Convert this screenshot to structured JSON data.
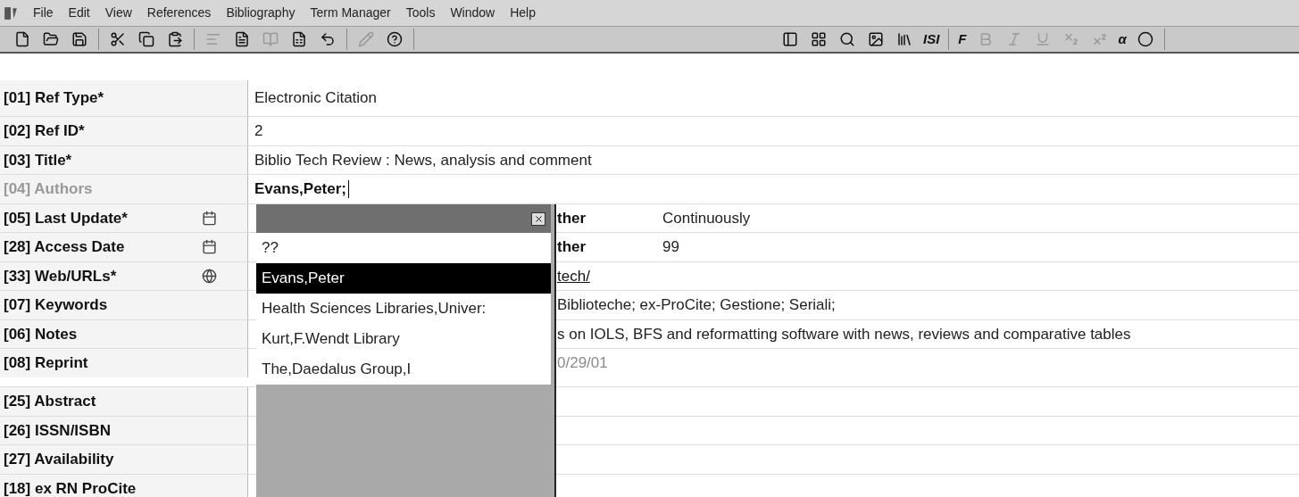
{
  "menu_bar": {
    "items": [
      "File",
      "Edit",
      "View",
      "References",
      "Bibliography",
      "Term Manager",
      "Tools",
      "Window",
      "Help"
    ]
  },
  "toolbar": {
    "groups": [
      [
        {
          "kind": "new",
          "disabled": false
        },
        {
          "kind": "open",
          "disabled": false
        },
        {
          "kind": "save",
          "disabled": false
        }
      ],
      [
        {
          "kind": "cut",
          "disabled": false
        },
        {
          "kind": "copy",
          "disabled": false
        },
        {
          "kind": "paste",
          "disabled": false
        }
      ],
      [
        {
          "kind": "align",
          "disabled": true
        },
        {
          "kind": "document",
          "disabled": false
        },
        {
          "kind": "book",
          "disabled": true
        },
        {
          "kind": "sheet",
          "disabled": false
        },
        {
          "kind": "undo",
          "disabled": false
        }
      ],
      [
        {
          "kind": "pencil",
          "disabled": true
        },
        {
          "kind": "help",
          "disabled": false
        }
      ],
      [
        {
          "kind": "layout",
          "disabled": false
        },
        {
          "kind": "grid",
          "disabled": false
        },
        {
          "kind": "search",
          "disabled": false
        },
        {
          "kind": "image",
          "disabled": false
        },
        {
          "kind": "library",
          "disabled": false
        },
        {
          "kind": "text",
          "label": "ISI",
          "disabled": false
        }
      ],
      [
        {
          "kind": "text",
          "label": "F",
          "disabled": false
        },
        {
          "kind": "bold",
          "disabled": true
        },
        {
          "kind": "italic",
          "disabled": true
        },
        {
          "kind": "underline",
          "disabled": true
        },
        {
          "kind": "subscript",
          "disabled": true
        },
        {
          "kind": "superscript",
          "disabled": true
        },
        {
          "kind": "text",
          "label": "α",
          "disabled": false
        },
        {
          "kind": "dot",
          "disabled": false
        }
      ]
    ]
  },
  "fields": [
    {
      "label": "[01] Ref Type*",
      "dimmed": false,
      "kind": "plain",
      "value": "Electronic Citation"
    },
    {
      "label": "[02] Ref ID*",
      "dimmed": false,
      "kind": "plain",
      "value": "2"
    },
    {
      "label": "[03] Title*",
      "dimmed": false,
      "kind": "plain",
      "value": "Biblio Tech Review : News, analysis and comment"
    },
    {
      "label": "[04] Authors",
      "dimmed": true,
      "kind": "editing",
      "value": "Evans,Peter;"
    },
    {
      "label": "[05] Last Update*",
      "dimmed": false,
      "kind": "date",
      "value": "ther",
      "extra": "Continuously"
    },
    {
      "label": "[28] Access Date",
      "dimmed": false,
      "kind": "date",
      "value": "ther",
      "extra": "99"
    },
    {
      "label": "[33] Web/URLs*",
      "dimmed": false,
      "kind": "link",
      "value": "tech/"
    },
    {
      "label": "[07] Keywords",
      "dimmed": false,
      "kind": "plain",
      "value": "Biblioteche; ex-ProCite; Gestione; Seriali;"
    },
    {
      "label": "[06] Notes",
      "dimmed": false,
      "kind": "plain",
      "value": "s on IOLS, BFS and reformatting software with news, reviews and comparative tables"
    },
    {
      "label": "[08] Reprint",
      "dimmed": false,
      "kind": "faded",
      "value": "0/29/01"
    },
    {
      "label": "[25] Abstract",
      "dimmed": false,
      "kind": "empty"
    },
    {
      "label": "[26] ISSN/ISBN",
      "dimmed": false,
      "kind": "empty"
    },
    {
      "label": "[27] Availability",
      "dimmed": false,
      "kind": "empty"
    },
    {
      "label": "[18] ex RN ProCite",
      "dimmed": false,
      "kind": "empty"
    }
  ],
  "picker": {
    "items": [
      {
        "label": "??",
        "selected": false
      },
      {
        "label": "Evans,Peter",
        "selected": true
      },
      {
        "label": "Health Sciences Libraries,Univer:",
        "selected": false
      },
      {
        "label": "Kurt,F.Wendt Library",
        "selected": false
      },
      {
        "label": "The,Daedalus Group,I",
        "selected": false
      }
    ]
  }
}
